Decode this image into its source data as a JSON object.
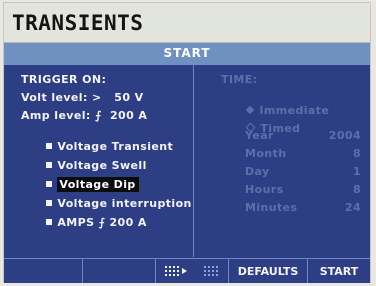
{
  "title": "TRANSIENTS",
  "subhead": "START",
  "trigger": {
    "heading": "TRIGGER ON:",
    "volt_level": "Volt level: >   50 V",
    "amp_level": "Amp level: ⨍  200 A",
    "options": [
      {
        "label": "Voltage Transient",
        "selected": false
      },
      {
        "label": "Voltage Swell",
        "selected": false
      },
      {
        "label": "Voltage Dip",
        "selected": true
      },
      {
        "label": "Voltage interruption",
        "selected": false
      },
      {
        "label": "AMPS ⨍ 200 A",
        "selected": false
      }
    ]
  },
  "time": {
    "heading": "TIME:",
    "immediate": "Immediate",
    "timed": "Timed",
    "fields": [
      {
        "label": "Year",
        "value": "2004"
      },
      {
        "label": "Month",
        "value": "8"
      },
      {
        "label": "Day",
        "value": "1"
      },
      {
        "label": "Hours",
        "value": "8"
      },
      {
        "label": "Minutes",
        "value": "24"
      }
    ]
  },
  "softkeys": {
    "defaults": "DEFAULTS",
    "start": "START"
  },
  "colors": {
    "panel": "#2d3e84",
    "header": "#6f91c1",
    "titlebar": "#e2e4de",
    "dim_text": "#5d6faa",
    "text": "#f4f4f8"
  }
}
